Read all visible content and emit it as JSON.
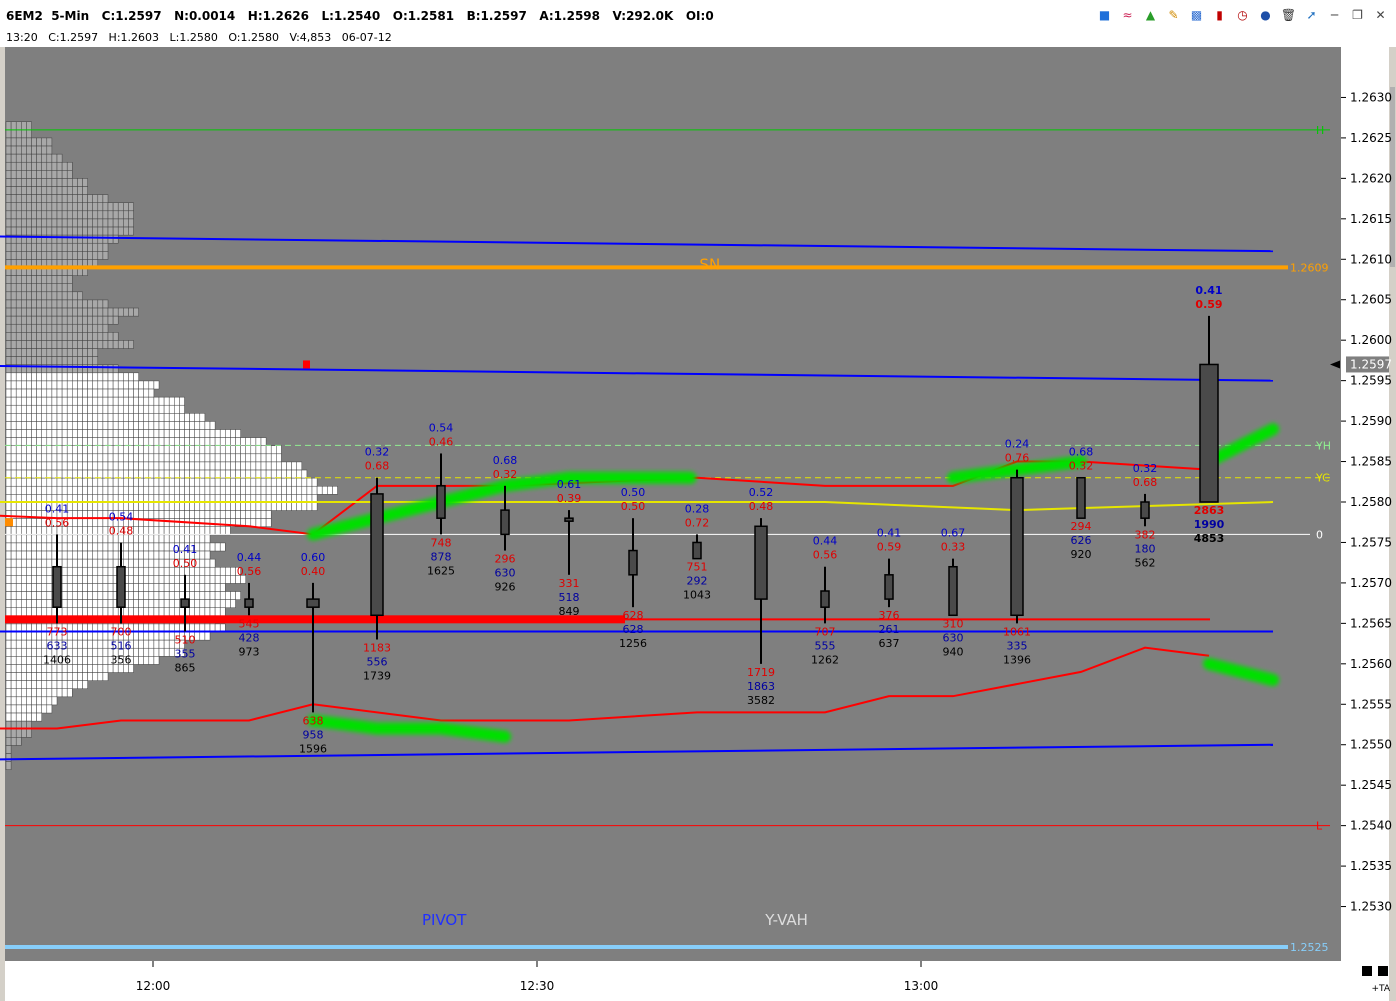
{
  "window": {
    "title": "6EM2  5-Min   C:1.2597   N:0.0014   H:1.2626   L:1.2540   O:1.2581   B:1.2597   A:1.2598   V:292.0K   OI:0",
    "info": "13:20   C:1.2597   H:1.2603   L:1.2580   O:1.2580   V:4,853   06-07-12",
    "toolbar_icons": [
      "cube-icon",
      "rainbow-icon",
      "tree-icon",
      "pencil-icon",
      "bars-icon",
      "candle-icon",
      "clock-icon",
      "circle-icon",
      "trash-icon",
      "pin-icon",
      "minimize-icon",
      "restore-icon",
      "close-icon"
    ],
    "ta_label": "+TA"
  },
  "chart_data": {
    "type": "candlestick",
    "y_axis": {
      "min": 1.2525,
      "max": 1.2635,
      "ticks": [
        "1.2630",
        "1.2625",
        "1.2620",
        "1.2615",
        "1.2610",
        "1.2605",
        "1.2600",
        "1.2595",
        "1.2590",
        "1.2585",
        "1.2580",
        "1.2575",
        "1.2570",
        "1.2565",
        "1.2560",
        "1.2555",
        "1.2550",
        "1.2545",
        "1.2540",
        "1.2535",
        "1.2530"
      ]
    },
    "x_axis": {
      "ticks": [
        {
          "label": "12:00",
          "bar": 1.5
        },
        {
          "label": "12:30",
          "bar": 7.5
        },
        {
          "label": "13:00",
          "bar": 13.5
        }
      ]
    },
    "last_price": {
      "value": 1.2597,
      "label": "1.2597"
    },
    "candles": [
      {
        "o": 1.2572,
        "h": 1.2576,
        "l": 1.2565,
        "c": 1.2567,
        "up": "0.41",
        "dn": "0.56",
        "v1": "773",
        "v2": "633",
        "v3": "1406"
      },
      {
        "o": 1.2572,
        "h": 1.2575,
        "l": 1.2565,
        "c": 1.2567,
        "up": "0.54",
        "dn": "0.48",
        "v1": "700",
        "v2": "516",
        "v3": "356"
      },
      {
        "o": 1.2568,
        "h": 1.2571,
        "l": 1.2564,
        "c": 1.2567,
        "up": "0.41",
        "dn": "0.50",
        "v1": "510",
        "v2": "355",
        "v3": "865"
      },
      {
        "o": 1.2568,
        "h": 1.257,
        "l": 1.2566,
        "c": 1.2567,
        "up": "0.44",
        "dn": "0.56",
        "v1": "545",
        "v2": "428",
        "v3": "973"
      },
      {
        "o": 1.2567,
        "h": 1.257,
        "l": 1.2554,
        "c": 1.2568,
        "up": "0.60",
        "dn": "0.40",
        "v1": "638",
        "v2": "958",
        "v3": "1596"
      },
      {
        "o": 1.2566,
        "h": 1.2583,
        "l": 1.2563,
        "c": 1.2581,
        "up": "0.32",
        "dn": "0.68",
        "v1": "1183",
        "v2": "556",
        "v3": "1739"
      },
      {
        "o": 1.2578,
        "h": 1.2586,
        "l": 1.2576,
        "c": 1.2582,
        "up": "0.54",
        "dn": "0.46",
        "v1": "748",
        "v2": "878",
        "v3": "1625"
      },
      {
        "o": 1.2576,
        "h": 1.2582,
        "l": 1.2574,
        "c": 1.2579,
        "up": "0.68",
        "dn": "0.32",
        "v1": "296",
        "v2": "630",
        "v3": "926"
      },
      {
        "o": 1.2578,
        "h": 1.2579,
        "l": 1.2571,
        "c": 1.2578,
        "up": "0.61",
        "dn": "0.39",
        "v1": "331",
        "v2": "518",
        "v3": "849"
      },
      {
        "o": 1.2571,
        "h": 1.2578,
        "l": 1.2567,
        "c": 1.2574,
        "up": "0.50",
        "dn": "0.50",
        "v1": "628",
        "v2": "628",
        "v3": "1256"
      },
      {
        "o": 1.2573,
        "h": 1.2576,
        "l": 1.2573,
        "c": 1.2575,
        "up": "0.28",
        "dn": "0.72",
        "v1": "751",
        "v2": "292",
        "v3": "1043"
      },
      {
        "o": 1.2577,
        "h": 1.2578,
        "l": 1.256,
        "c": 1.2568,
        "up": "0.52",
        "dn": "0.48",
        "v1": "1719",
        "v2": "1863",
        "v3": "3582"
      },
      {
        "o": 1.2567,
        "h": 1.2572,
        "l": 1.2565,
        "c": 1.2569,
        "up": "0.44",
        "dn": "0.56",
        "v1": "707",
        "v2": "555",
        "v3": "1262"
      },
      {
        "o": 1.2568,
        "h": 1.2573,
        "l": 1.2567,
        "c": 1.2571,
        "up": "0.41",
        "dn": "0.59",
        "v1": "376",
        "v2": "261",
        "v3": "637"
      },
      {
        "o": 1.2566,
        "h": 1.2573,
        "l": 1.2566,
        "c": 1.2572,
        "up": "0.67",
        "dn": "0.33",
        "v1": "310",
        "v2": "630",
        "v3": "940"
      },
      {
        "o": 1.2566,
        "h": 1.2584,
        "l": 1.2565,
        "c": 1.2583,
        "up": "0.24",
        "dn": "0.76",
        "v1": "1061",
        "v2": "335",
        "v3": "1396"
      },
      {
        "o": 1.2578,
        "h": 1.2583,
        "l": 1.2578,
        "c": 1.2583,
        "up": "0.68",
        "dn": "0.32",
        "v1": "294",
        "v2": "626",
        "v3": "920"
      },
      {
        "o": 1.2578,
        "h": 1.2581,
        "l": 1.2577,
        "c": 1.258,
        "up": "0.32",
        "dn": "0.68",
        "v1": "382",
        "v2": "180",
        "v3": "562"
      },
      {
        "o": 1.258,
        "h": 1.2603,
        "l": 1.258,
        "c": 1.2597,
        "up": "0.41",
        "dn": "0.59",
        "v1": "2863",
        "v2": "1990",
        "v3": "4853",
        "bold": true
      }
    ],
    "horizontal_lines": [
      {
        "price": 1.2626,
        "color": "#00c800",
        "style": "solid",
        "label": "H"
      },
      {
        "price": 1.2609,
        "color": "#ffa000",
        "style": "thick",
        "label": "1.2609"
      },
      {
        "price": 1.2587,
        "color": "#90ee90",
        "style": "dashed",
        "label": "YH"
      },
      {
        "price": 1.2583,
        "color": "#e6e600",
        "style": "dashed",
        "label": "YC"
      },
      {
        "price": 1.2576,
        "color": "#ffffff",
        "style": "solid",
        "label": "0"
      },
      {
        "price": 1.254,
        "color": "#ff0000",
        "style": "solid",
        "label": "L"
      },
      {
        "price": 1.2525,
        "color": "#87cefa",
        "style": "thick",
        "label": "1.2525"
      }
    ],
    "red_band": {
      "price": 1.25655
    },
    "text_labels": [
      {
        "text": "SN",
        "bar": 10.2,
        "price": 1.2607,
        "color": "#ffa000"
      },
      {
        "text": "PIVOT",
        "bar": 6.05,
        "price": 1.2526,
        "color": "#2030ff"
      },
      {
        "text": "Y-VAH",
        "bar": 11.4,
        "price": 1.2526,
        "color": "#dddddd"
      }
    ],
    "band_lines": [
      {
        "color": "#0000ff",
        "points": [
          [
            -3,
            1.2613
          ],
          [
            19,
            1.2611
          ]
        ]
      },
      {
        "color": "#0000ff",
        "points": [
          [
            -3,
            1.2597
          ],
          [
            19,
            1.2595
          ]
        ]
      },
      {
        "color": "#0000ff",
        "points": [
          [
            -3,
            1.2564
          ],
          [
            19,
            1.2564
          ]
        ]
      },
      {
        "color": "#0000ff",
        "points": [
          [
            -3,
            1.2548
          ],
          [
            19,
            1.255
          ]
        ]
      },
      {
        "color": "#ff0000",
        "points": [
          [
            -3,
            1.2579
          ],
          [
            0,
            1.2578
          ],
          [
            1,
            1.2578
          ],
          [
            3,
            1.2577
          ],
          [
            4,
            1.2576
          ],
          [
            5,
            1.2582
          ],
          [
            7,
            1.2582
          ],
          [
            10,
            1.2583
          ],
          [
            12,
            1.2582
          ],
          [
            14,
            1.2582
          ],
          [
            15,
            1.2585
          ],
          [
            16,
            1.2585
          ],
          [
            18,
            1.2584
          ]
        ]
      },
      {
        "color": "#e6e600",
        "points": [
          [
            -3,
            1.258
          ],
          [
            4,
            1.258
          ],
          [
            9,
            1.258
          ],
          [
            12,
            1.258
          ],
          [
            15,
            1.2579
          ],
          [
            19,
            1.258
          ]
        ]
      },
      {
        "color": "#ff0000",
        "points": [
          [
            -3,
            1.2552
          ],
          [
            0,
            1.2552
          ],
          [
            1,
            1.2553
          ],
          [
            3,
            1.2553
          ],
          [
            4,
            1.2555
          ],
          [
            6,
            1.2553
          ],
          [
            8,
            1.2553
          ],
          [
            10,
            1.2554
          ],
          [
            12,
            1.2554
          ],
          [
            13,
            1.2556
          ],
          [
            14,
            1.2556
          ],
          [
            16,
            1.2559
          ],
          [
            17,
            1.2562
          ],
          [
            18,
            1.2561
          ]
        ]
      }
    ],
    "green_segments": [
      [
        [
          1,
          1.2579
        ],
        [
          2,
          1.2579
        ]
      ],
      [
        [
          4,
          1.2576
        ],
        [
          5,
          1.2578
        ],
        [
          6,
          1.258
        ],
        [
          7,
          1.2582
        ],
        [
          8,
          1.2583
        ],
        [
          9,
          1.2583
        ],
        [
          9.9,
          1.2583
        ]
      ],
      [
        [
          11,
          1.2582
        ],
        [
          12,
          1.2582
        ],
        [
          12.6,
          1.2582
        ]
      ],
      [
        [
          14,
          1.2583
        ],
        [
          15,
          1.2584
        ],
        [
          16,
          1.2585
        ]
      ],
      [
        [
          18,
          1.2585
        ],
        [
          19,
          1.2589
        ]
      ],
      [
        [
          4,
          1.2553
        ],
        [
          5,
          1.2552
        ],
        [
          6,
          1.2552
        ],
        [
          7,
          1.2551
        ]
      ],
      [
        [
          10,
          1.2553
        ],
        [
          11,
          1.2553
        ]
      ],
      [
        [
          18,
          1.256
        ],
        [
          19,
          1.2558
        ]
      ]
    ],
    "volume_profile_widths": [
      5,
      5,
      9,
      9,
      11,
      13,
      13,
      16,
      16,
      20,
      25,
      25,
      25,
      25,
      22,
      20,
      20,
      18,
      16,
      13,
      13,
      15,
      20,
      26,
      22,
      20,
      22,
      25,
      18,
      18,
      22,
      26,
      30,
      29,
      35,
      35,
      39,
      41,
      46,
      51,
      54,
      54,
      58,
      59,
      61,
      65,
      61,
      61,
      52,
      52,
      44,
      40,
      43,
      40,
      41,
      46,
      47,
      43,
      46,
      45,
      43,
      41,
      43,
      40,
      35,
      35,
      30,
      25,
      20,
      16,
      13,
      10,
      9,
      7,
      5,
      5,
      3,
      1,
      1,
      1
    ]
  }
}
